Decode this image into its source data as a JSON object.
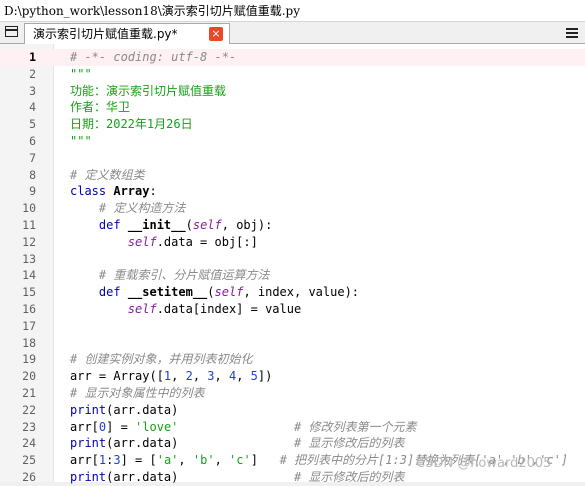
{
  "window": {
    "title": "D:\\python_work\\lesson18\\演示索引切片赋值重载.py"
  },
  "tabs": [
    {
      "label": "演示索引切片赋值重载.py*",
      "close_label": "×"
    }
  ],
  "icons": {
    "panel": "panel-toggle-icon",
    "menu": "hamburger-menu-icon",
    "close": "close-icon"
  },
  "colors": {
    "comment": "#8a8a8a",
    "string": "#18a018",
    "keyword": "#0000b8",
    "current_line": "#fff0f4",
    "close_button": "#e8492b"
  },
  "editor": {
    "current_line": 1,
    "lines": [
      [
        {
          "t": "# -*- coding: utf-8 -*-",
          "c": "c-com"
        }
      ],
      [
        {
          "t": "\"\"\"",
          "c": "c-str"
        }
      ],
      [
        {
          "t": "功能：演示索引切片赋值重载",
          "c": "c-str"
        }
      ],
      [
        {
          "t": "作者：华卫",
          "c": "c-str"
        }
      ],
      [
        {
          "t": "日期：2022年1月26日",
          "c": "c-str"
        }
      ],
      [
        {
          "t": "\"\"\"",
          "c": "c-str"
        }
      ],
      [],
      [
        {
          "t": "# 定义数组类",
          "c": "c-com"
        }
      ],
      [
        {
          "t": "class ",
          "c": "c-kw"
        },
        {
          "t": "Array",
          "c": "c-fn"
        },
        {
          "t": ":"
        }
      ],
      [
        {
          "t": "    "
        },
        {
          "t": "# 定义构造方法",
          "c": "c-com"
        }
      ],
      [
        {
          "t": "    "
        },
        {
          "t": "def ",
          "c": "c-kw"
        },
        {
          "t": "__init__",
          "c": "c-fn"
        },
        {
          "t": "("
        },
        {
          "t": "self",
          "c": "c-self"
        },
        {
          "t": ", obj):"
        }
      ],
      [
        {
          "t": "        "
        },
        {
          "t": "self",
          "c": "c-self"
        },
        {
          "t": ".data = obj[:]"
        }
      ],
      [],
      [
        {
          "t": "    "
        },
        {
          "t": "# 重载索引、分片赋值运算方法",
          "c": "c-com"
        }
      ],
      [
        {
          "t": "    "
        },
        {
          "t": "def ",
          "c": "c-kw"
        },
        {
          "t": "__setitem__",
          "c": "c-fn"
        },
        {
          "t": "("
        },
        {
          "t": "self",
          "c": "c-self"
        },
        {
          "t": ", index, value):"
        }
      ],
      [
        {
          "t": "        "
        },
        {
          "t": "self",
          "c": "c-self"
        },
        {
          "t": ".data[index] = value"
        }
      ],
      [],
      [],
      [
        {
          "t": "# 创建实例对象，并用列表初始化",
          "c": "c-com"
        }
      ],
      [
        {
          "t": "arr = Array(["
        },
        {
          "t": "1",
          "c": "c-num"
        },
        {
          "t": ", "
        },
        {
          "t": "2",
          "c": "c-num"
        },
        {
          "t": ", "
        },
        {
          "t": "3",
          "c": "c-num"
        },
        {
          "t": ", "
        },
        {
          "t": "4",
          "c": "c-num"
        },
        {
          "t": ", "
        },
        {
          "t": "5",
          "c": "c-num"
        },
        {
          "t": "])"
        }
      ],
      [
        {
          "t": "# 显示对象属性中的列表",
          "c": "c-com"
        }
      ],
      [
        {
          "t": "print",
          "c": "c-kw"
        },
        {
          "t": "(arr.data)"
        }
      ],
      [
        {
          "t": "arr["
        },
        {
          "t": "0",
          "c": "c-num"
        },
        {
          "t": "] = "
        },
        {
          "t": "'love'",
          "c": "c-str"
        },
        {
          "t": "                "
        },
        {
          "t": "# 修改列表第一个元素",
          "c": "c-com"
        }
      ],
      [
        {
          "t": "print",
          "c": "c-kw"
        },
        {
          "t": "(arr.data)"
        },
        {
          "t": "                "
        },
        {
          "t": "# 显示修改后的列表",
          "c": "c-com"
        }
      ],
      [
        {
          "t": "arr["
        },
        {
          "t": "1",
          "c": "c-num"
        },
        {
          "t": ":"
        },
        {
          "t": "3",
          "c": "c-num"
        },
        {
          "t": "] = ["
        },
        {
          "t": "'a'",
          "c": "c-str"
        },
        {
          "t": ", "
        },
        {
          "t": "'b'",
          "c": "c-str"
        },
        {
          "t": ", "
        },
        {
          "t": "'c'",
          "c": "c-str"
        },
        {
          "t": "]   "
        },
        {
          "t": "# 把列表中的分片[1:3]替换为列表['a','b','c']",
          "c": "c-com"
        }
      ],
      [
        {
          "t": "print",
          "c": "c-kw"
        },
        {
          "t": "(arr.data)"
        },
        {
          "t": "                "
        },
        {
          "t": "# 显示修改后的列表",
          "c": "c-com"
        }
      ]
    ]
  },
  "watermark": "CSDN @howard2005"
}
